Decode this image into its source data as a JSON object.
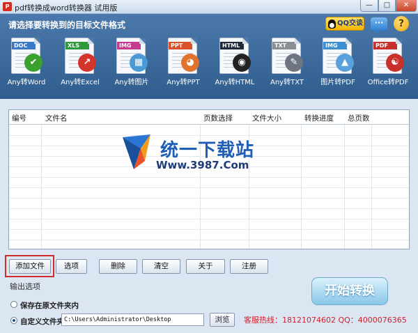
{
  "window": {
    "title": "pdf转换成word转换器 试用版",
    "app_icon_glyph": "P",
    "minimize": "—",
    "maximize": "□",
    "close": "✕"
  },
  "header": {
    "title": "请选择要转换到的目标文件格式",
    "qq_label": "QQ交谈",
    "chat_glyph": "···",
    "help_glyph": "?"
  },
  "converters": [
    {
      "label": "Any转Word",
      "band": "DOC",
      "band_color": "#3a78c9",
      "glyph": "✔",
      "glyph_color": "#3aa02e",
      "icon": "word-convert-icon"
    },
    {
      "label": "Any转Excel",
      "band": "XLS",
      "band_color": "#2f9a3a",
      "glyph": "↗",
      "glyph_color": "#d3342b",
      "icon": "excel-convert-icon"
    },
    {
      "label": "Any转图片",
      "band": "IMG",
      "band_color": "#c63b8f",
      "glyph": "▦",
      "glyph_color": "#4a9ad8",
      "icon": "image-convert-icon"
    },
    {
      "label": "Any转PPT",
      "band": "PPT",
      "band_color": "#d8532a",
      "glyph": "◕",
      "glyph_color": "#e0732d",
      "icon": "ppt-convert-icon"
    },
    {
      "label": "Any转HTML",
      "band": "HTML",
      "band_color": "#1f2b3a",
      "glyph": "◉",
      "glyph_color": "#222222",
      "icon": "html-convert-icon"
    },
    {
      "label": "Any转TXT",
      "band": "TXT",
      "band_color": "#8a8f96",
      "glyph": "✎",
      "glyph_color": "#6e7580",
      "icon": "txt-convert-icon"
    },
    {
      "label": "图片转PDF",
      "band": "IMG",
      "band_color": "#3d8fd1",
      "glyph": "▲",
      "glyph_color": "#5aa0dc",
      "icon": "image-to-pdf-icon"
    },
    {
      "label": "Office转PDF",
      "band": "PDF",
      "band_color": "#c9302c",
      "glyph": "☯",
      "glyph_color": "#c9302c",
      "icon": "office-to-pdf-icon"
    }
  ],
  "table": {
    "columns": [
      "编号",
      "文件名",
      "页数选择",
      "文件大小",
      "转换进度",
      "总页数"
    ],
    "rows": []
  },
  "watermark": {
    "title": "统一下载站",
    "url": "Www.3987.Com"
  },
  "actions": {
    "add_file": "添加文件",
    "options": "选项",
    "delete": "删除",
    "clear": "清空",
    "about": "关于",
    "register": "注册"
  },
  "output": {
    "section_label": "输出选项",
    "option_original": "保存在原文件夹内",
    "option_custom": "自定义文件夹",
    "selected": "custom",
    "path": "C:\\Users\\Administrator\\Desktop",
    "browse": "浏览"
  },
  "start_button": "开始转换",
  "hotline": "客服热线：18121074602 QQ：4000076365",
  "colors": {
    "header_bg": "#3f6c9d",
    "accent_red": "#d12b2b",
    "start_button": "#89c7e9"
  }
}
